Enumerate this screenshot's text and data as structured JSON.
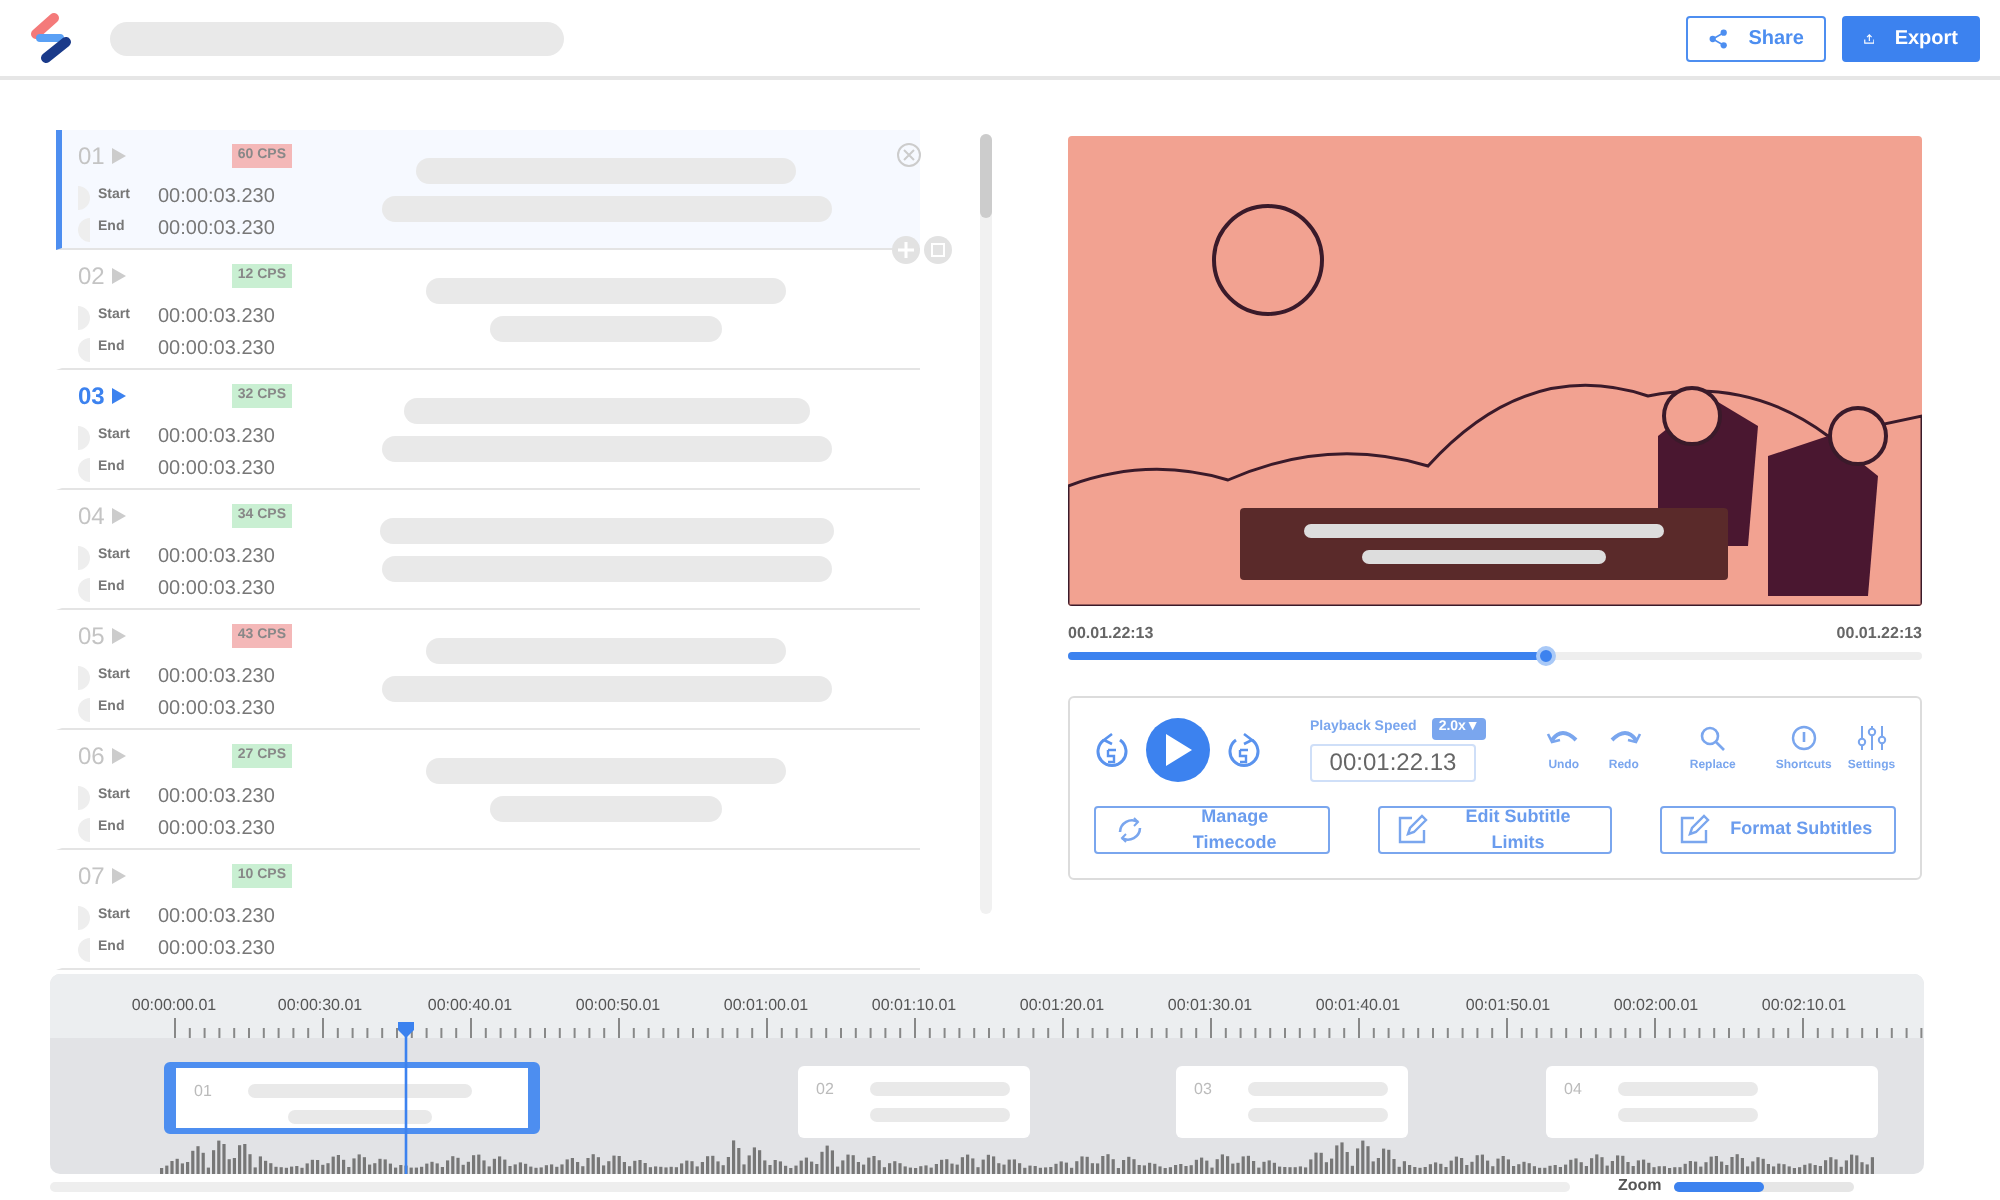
{
  "header": {
    "buttons": [
      {
        "label": "Share",
        "kind": "outline"
      },
      {
        "label": "Export",
        "kind": "solid"
      }
    ]
  },
  "subtitles": [
    {
      "number": "01",
      "cps": "60 CPS",
      "color": "#f4b8b8",
      "selected": true,
      "playing": false,
      "start_label": "Start",
      "start": "00:00:03.230",
      "end_label": "End",
      "end": "00:00:03.230"
    },
    {
      "number": "02",
      "cps": "12 CPS",
      "color": "#c9efd2",
      "selected": false,
      "playing": false,
      "start_label": "Start",
      "start": "00:00:03.230",
      "end_label": "End",
      "end": "00:00:03.230"
    },
    {
      "number": "03",
      "cps": "32 CPS",
      "color": "#c9efd2",
      "selected": false,
      "playing": true,
      "start_label": "Start",
      "start": "00:00:03.230",
      "end_label": "End",
      "end": "00:00:03.230"
    },
    {
      "number": "04",
      "cps": "34 CPS",
      "color": "#c9efd2",
      "selected": false,
      "playing": false,
      "start_label": "Start",
      "start": "00:00:03.230",
      "end_label": "End",
      "end": "00:00:03.230"
    },
    {
      "number": "05",
      "cps": "43 CPS",
      "color": "#f4b8b8",
      "selected": false,
      "playing": false,
      "start_label": "Start",
      "start": "00:00:03.230",
      "end_label": "End",
      "end": "00:00:03.230"
    },
    {
      "number": "06",
      "cps": "27 CPS",
      "color": "#c9efd2",
      "selected": false,
      "playing": false,
      "start_label": "Start",
      "start": "00:00:03.230",
      "end_label": "End",
      "end": "00:00:03.230"
    },
    {
      "number": "07",
      "cps": "10 CPS",
      "color": "#c9efd2",
      "selected": false,
      "playing": false,
      "start_label": "Start",
      "start": "00:00:03.230",
      "end_label": "End",
      "end": "00:00:03.230"
    }
  ],
  "player": {
    "current": "00.01.22:13",
    "duration": "00.01.22:13",
    "level": 0.56
  },
  "controls": {
    "speed_label": "Playback Speed",
    "speed": "2.0x▼",
    "timecode": "00:01:22.13",
    "tools": [
      {
        "label": "Undo",
        "kind": "undo"
      },
      {
        "label": "Redo",
        "kind": "redo"
      },
      {
        "label": "Replace",
        "kind": "search"
      },
      {
        "label": "Shortcuts",
        "kind": "info"
      },
      {
        "label": "Settings",
        "kind": "sliders"
      }
    ],
    "actions": [
      {
        "label": "Manage Timecode",
        "kind": "sync"
      },
      {
        "label": "Edit Subtitle Limits",
        "kind": "edit"
      },
      {
        "label": "Format Subtitles",
        "kind": "edit"
      }
    ]
  },
  "timeline": {
    "ticks": [
      "00:00:00.01",
      "00:00:30.01",
      "00:00:40.01",
      "00:00:50.01",
      "00:01:00.01",
      "00:01:10.01",
      "00:01:20.01",
      "00:01:30.01",
      "00:01:40.01",
      "00:01:50.01",
      "00:02:00.01",
      "00:02:10.01"
    ],
    "level": 0.19,
    "clips": [
      {
        "number": "01",
        "selected": true
      },
      {
        "number": "02",
        "selected": false
      },
      {
        "number": "03",
        "selected": false
      },
      {
        "number": "04",
        "selected": false
      }
    ],
    "zoom": {
      "label": "Zoom",
      "level": 0.5
    }
  }
}
